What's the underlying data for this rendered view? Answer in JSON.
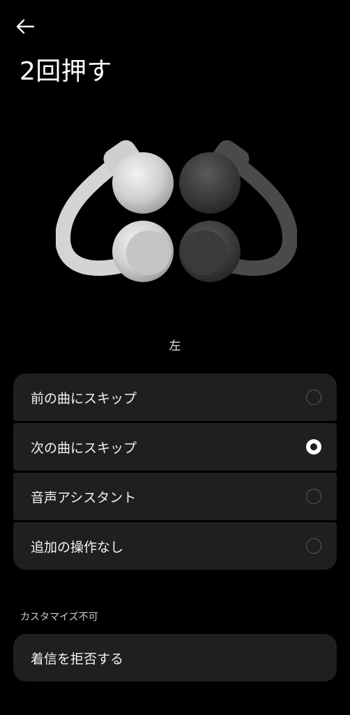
{
  "header": {
    "back_icon": "arrow-left-icon",
    "title": "2回押す"
  },
  "illustration": {
    "left_earbud_color": "#d9d9d9",
    "right_earbud_color": "#3a3a3a"
  },
  "side_label": "左",
  "options": [
    {
      "label": "前の曲にスキップ",
      "selected": false
    },
    {
      "label": "次の曲にスキップ",
      "selected": true
    },
    {
      "label": "音声アシスタント",
      "selected": false
    },
    {
      "label": "追加の操作なし",
      "selected": false
    }
  ],
  "non_customizable": {
    "heading": "カスタマイズ不可",
    "item_label": "着信を拒否する"
  },
  "colors": {
    "background": "#000000",
    "card": "#1f1f1f",
    "accent": "#ffffff"
  }
}
